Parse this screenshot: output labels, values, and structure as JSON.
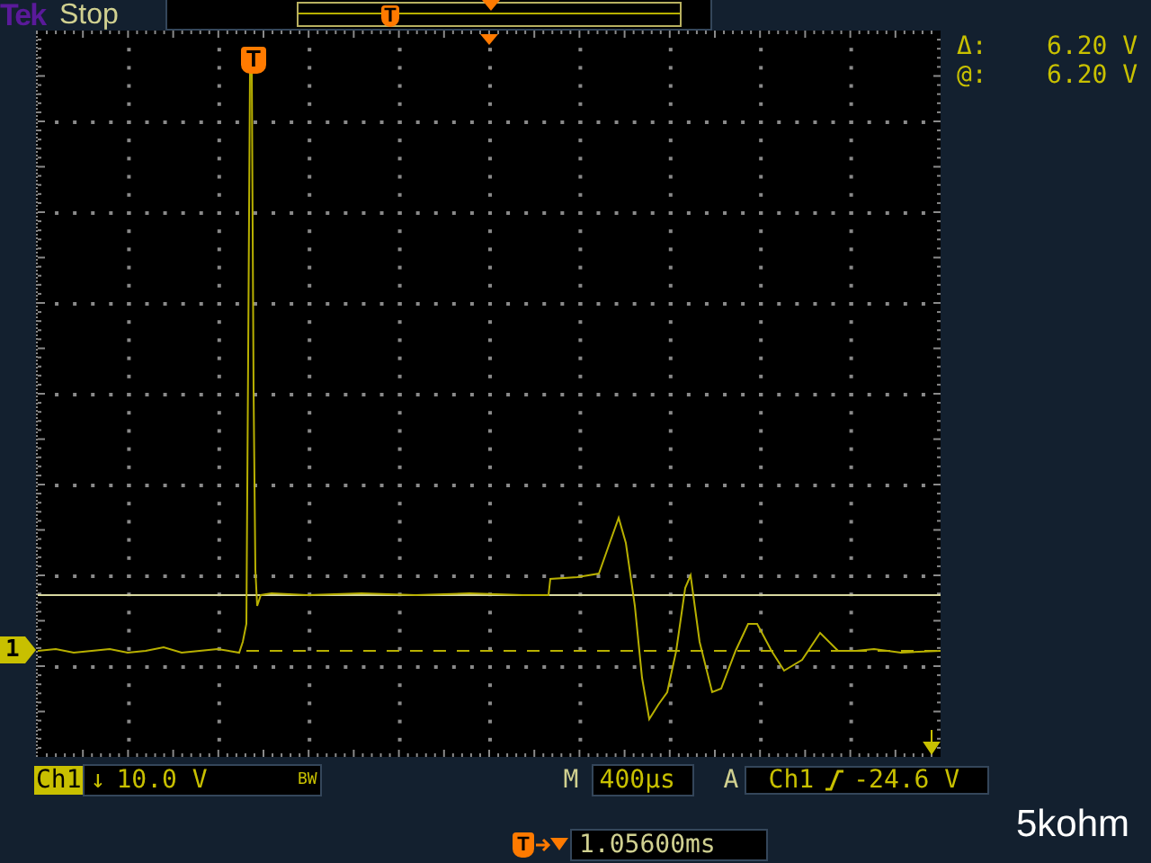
{
  "header": {
    "brand": "Tek",
    "run_state": "Stop",
    "record_trigger_marker": "T"
  },
  "cursor_readouts": [
    {
      "symbol": "Δ:",
      "value": "6.20 V"
    },
    {
      "symbol": "@:",
      "value": "6.20 V"
    }
  ],
  "channel_marker": "1",
  "trigger_marker": "T",
  "status": {
    "channel": "Ch1",
    "coupling": "↓",
    "scale": "10.0 V",
    "bandwidth_limit": "BW",
    "timebase_label": "M",
    "timebase": "400µs",
    "acquisition_label": "A",
    "trigger_source": "Ch1",
    "trigger_level": "-24.6 V"
  },
  "trigger_position": {
    "marker": "T",
    "value": "1.05600ms"
  },
  "note": "5kohm"
}
